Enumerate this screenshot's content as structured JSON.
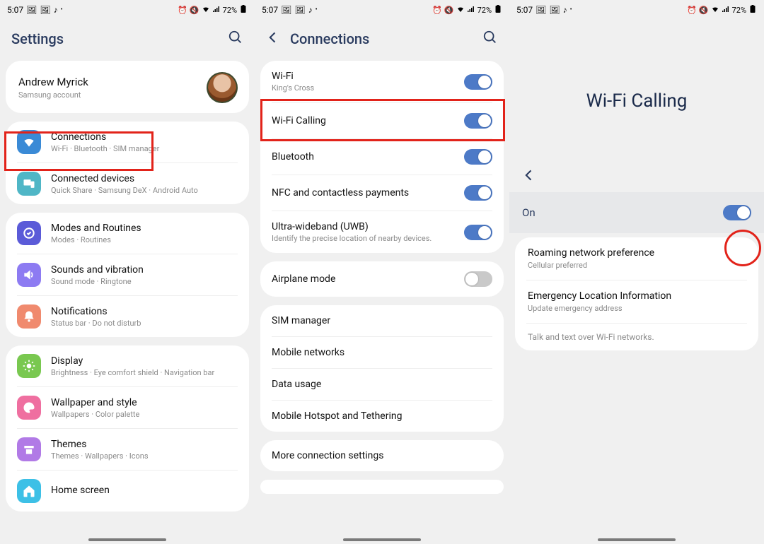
{
  "status": {
    "time": "5:07",
    "battery": "72%"
  },
  "s1": {
    "title": "Settings",
    "account": {
      "name": "Andrew Myrick",
      "sub": "Samsung account"
    },
    "items": [
      {
        "label": "Connections",
        "sub": "Wi-Fi  ·  Bluetooth  ·  SIM manager",
        "color": "#3a8ad6"
      },
      {
        "label": "Connected devices",
        "sub": "Quick Share  ·  Samsung DeX  ·  Android Auto",
        "color": "#4fb6c6"
      },
      {
        "label": "Modes and Routines",
        "sub": "Modes  ·  Routines",
        "color": "#5b5bd8"
      },
      {
        "label": "Sounds and vibration",
        "sub": "Sound mode  ·  Ringtone",
        "color": "#8d7bf2"
      },
      {
        "label": "Notifications",
        "sub": "Status bar  ·  Do not disturb",
        "color": "#f08a6e"
      },
      {
        "label": "Display",
        "sub": "Brightness  ·  Eye comfort shield  ·  Navigation bar",
        "color": "#79c850"
      },
      {
        "label": "Wallpaper and style",
        "sub": "Wallpapers  ·  Color palette",
        "color": "#ef6fa0"
      },
      {
        "label": "Themes",
        "sub": "Themes  ·  Wallpapers  ·  Icons",
        "color": "#b17ae6"
      },
      {
        "label": "Home screen",
        "sub": "",
        "color": "#3dc0e6"
      }
    ]
  },
  "s2": {
    "title": "Connections",
    "g1": [
      {
        "label": "Wi-Fi",
        "sub": "King's Cross",
        "toggle": true
      },
      {
        "label": "Wi-Fi Calling",
        "toggle": true,
        "highlight": true
      },
      {
        "label": "Bluetooth",
        "toggle": true
      },
      {
        "label": "NFC and contactless payments",
        "toggle": true
      },
      {
        "label": "Ultra-wideband (UWB)",
        "sub": "Identify the precise location of nearby devices.",
        "toggle": true
      }
    ],
    "g2": [
      {
        "label": "Airplane mode",
        "toggle": false
      }
    ],
    "g3": [
      {
        "label": "SIM manager"
      },
      {
        "label": "Mobile networks"
      },
      {
        "label": "Data usage"
      },
      {
        "label": "Mobile Hotspot and Tethering"
      }
    ],
    "g4": [
      {
        "label": "More connection settings"
      }
    ]
  },
  "s3": {
    "big": "Wi-Fi Calling",
    "on_label": "On",
    "rows": [
      {
        "label": "Roaming network preference",
        "sub": "Cellular preferred"
      },
      {
        "label": "Emergency Location Information",
        "sub": "Update emergency address"
      }
    ],
    "note": "Talk and text over Wi-Fi networks."
  }
}
